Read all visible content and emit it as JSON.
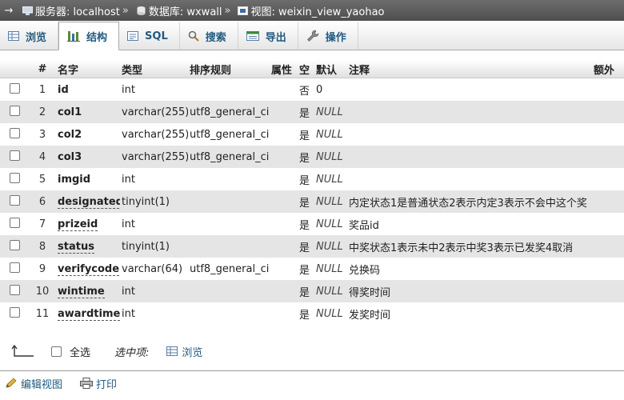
{
  "breadcrumb": {
    "back_arrow": "→",
    "server": "服务器: localhost",
    "database": "数据库: wxwall",
    "view": "视图: weixin_view_yaohao",
    "separator": "»"
  },
  "tabs": [
    {
      "label": "浏览",
      "icon": "browse-icon"
    },
    {
      "label": "结构",
      "icon": "structure-icon",
      "active": true
    },
    {
      "label": "SQL",
      "icon": "sql-icon"
    },
    {
      "label": "搜索",
      "icon": "search-icon"
    },
    {
      "label": "导出",
      "icon": "export-icon"
    },
    {
      "label": "操作",
      "icon": "wrench-icon"
    }
  ],
  "columns": [
    "#",
    "名字",
    "类型",
    "排序规则",
    "属性",
    "空",
    "默认",
    "注释",
    "额外"
  ],
  "rows": [
    {
      "num": "1",
      "name": "id",
      "type": "int",
      "collation": "",
      "nullable": "否",
      "default": "0",
      "comment": "",
      "underline": false
    },
    {
      "num": "2",
      "name": "col1",
      "type": "varchar(255)",
      "collation": "utf8_general_ci",
      "nullable": "是",
      "default": "NULL",
      "comment": "",
      "underline": false
    },
    {
      "num": "3",
      "name": "col2",
      "type": "varchar(255)",
      "collation": "utf8_general_ci",
      "nullable": "是",
      "default": "NULL",
      "comment": "",
      "underline": false
    },
    {
      "num": "4",
      "name": "col3",
      "type": "varchar(255)",
      "collation": "utf8_general_ci",
      "nullable": "是",
      "default": "NULL",
      "comment": "",
      "underline": false
    },
    {
      "num": "5",
      "name": "imgid",
      "type": "int",
      "collation": "",
      "nullable": "是",
      "default": "NULL",
      "comment": "",
      "underline": false
    },
    {
      "num": "6",
      "name": "designated",
      "type": "tinyint(1)",
      "collation": "",
      "nullable": "是",
      "default": "NULL",
      "comment": "内定状态1是普通状态2表示内定3表示不会中这个奖",
      "underline": true
    },
    {
      "num": "7",
      "name": "prizeid",
      "type": "int",
      "collation": "",
      "nullable": "是",
      "default": "NULL",
      "comment": "奖品id",
      "underline": true
    },
    {
      "num": "8",
      "name": "status",
      "type": "tinyint(1)",
      "collation": "",
      "nullable": "是",
      "default": "NULL",
      "comment": "中奖状态1表示未中2表示中奖3表示已发奖4取消",
      "underline": true
    },
    {
      "num": "9",
      "name": "verifycode",
      "type": "varchar(64)",
      "collation": "utf8_general_ci",
      "nullable": "是",
      "default": "NULL",
      "comment": "兑换码",
      "underline": true
    },
    {
      "num": "10",
      "name": "wintime",
      "type": "int",
      "collation": "",
      "nullable": "是",
      "default": "NULL",
      "comment": "得奖时间",
      "underline": true
    },
    {
      "num": "11",
      "name": "awardtime",
      "type": "int",
      "collation": "",
      "nullable": "是",
      "default": "NULL",
      "comment": "发奖时间",
      "underline": true
    }
  ],
  "footer": {
    "select_all": "全选",
    "with_selected": "选中项:",
    "browse": "浏览",
    "edit_view": "编辑视图",
    "print": "打印"
  },
  "colors": {
    "link": "#235a81",
    "topbar": "#5a5a5a",
    "row_even": "#e5e5e5"
  }
}
